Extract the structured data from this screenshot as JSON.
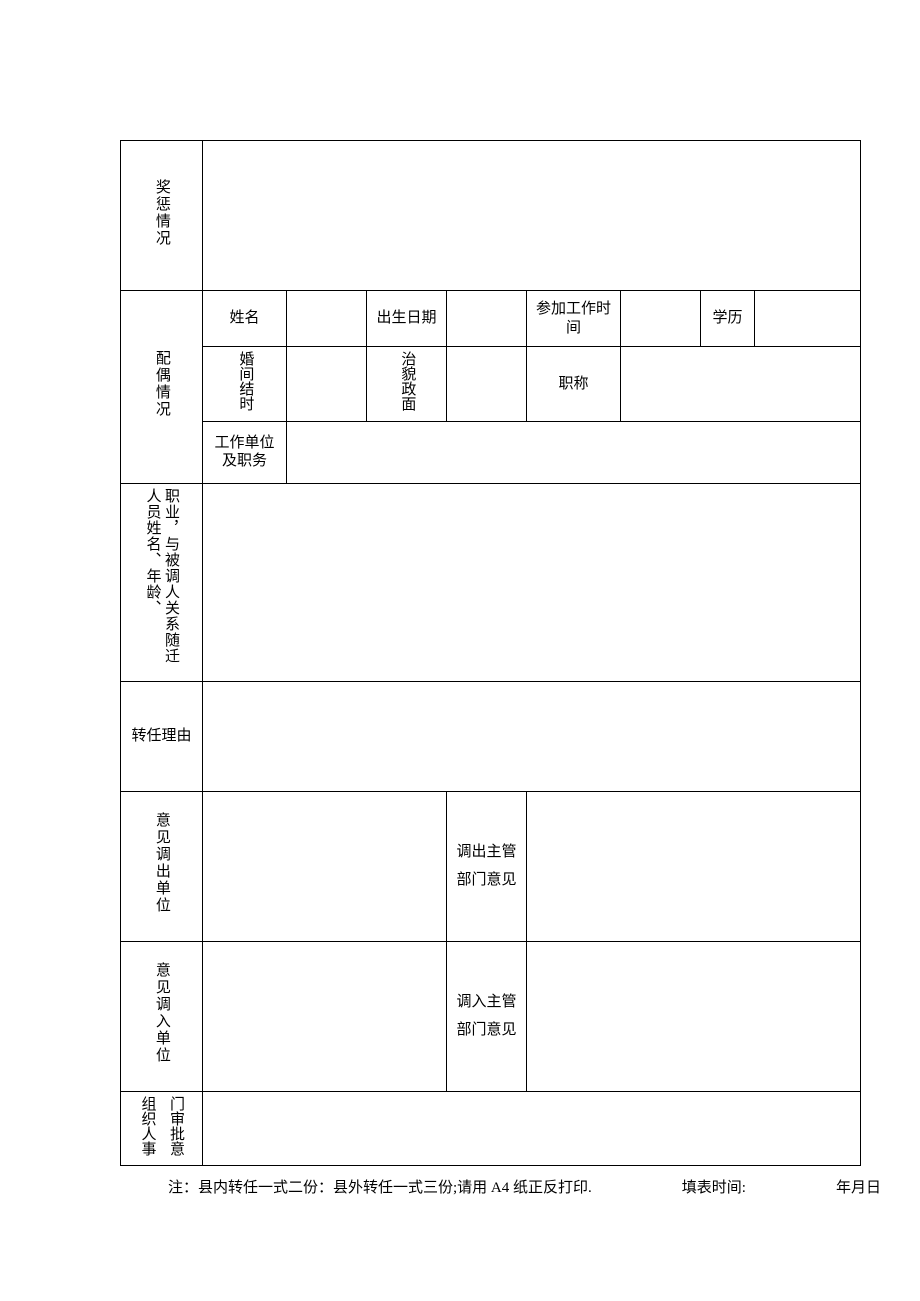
{
  "labels": {
    "award": "奖惩情况",
    "spouse_section": "配偶情况",
    "spouse_name": "姓名",
    "spouse_birth": "出生日期",
    "spouse_work_start": "参加工作时间",
    "spouse_edu": "学历",
    "spouse_marriage_time": "婚间结时",
    "spouse_political": "治貌政面",
    "spouse_title": "职称",
    "spouse_work_unit": "工作单位及职务",
    "follow_a": "职业，与被调人关系随迁",
    "follow_b": "人员姓名、年龄、",
    "reason": "转任理由",
    "opinion_out_unit": "意见调出单位",
    "opinion_out_dept": "调出主管部门意见",
    "opinion_in_unit": "意见调入单位",
    "opinion_in_dept": "调入主管部门意见",
    "org_a": "组织人事",
    "org_b": "门审批意",
    "footer_note": "注：县内转任一式二份：县外转任一式三份;请用 A4 纸正反打印.",
    "footer_fill": "填表时间:",
    "footer_date": "年月日"
  },
  "values": {
    "award": "",
    "spouse_name": "",
    "spouse_birth": "",
    "spouse_work_start": "",
    "spouse_edu": "",
    "spouse_marriage_time": "",
    "spouse_political": "",
    "spouse_title": "",
    "spouse_work_unit": "",
    "follow": "",
    "reason": "",
    "opinion_out_unit": "",
    "opinion_out_dept": "",
    "opinion_in_unit": "",
    "opinion_in_dept": "",
    "org": ""
  }
}
